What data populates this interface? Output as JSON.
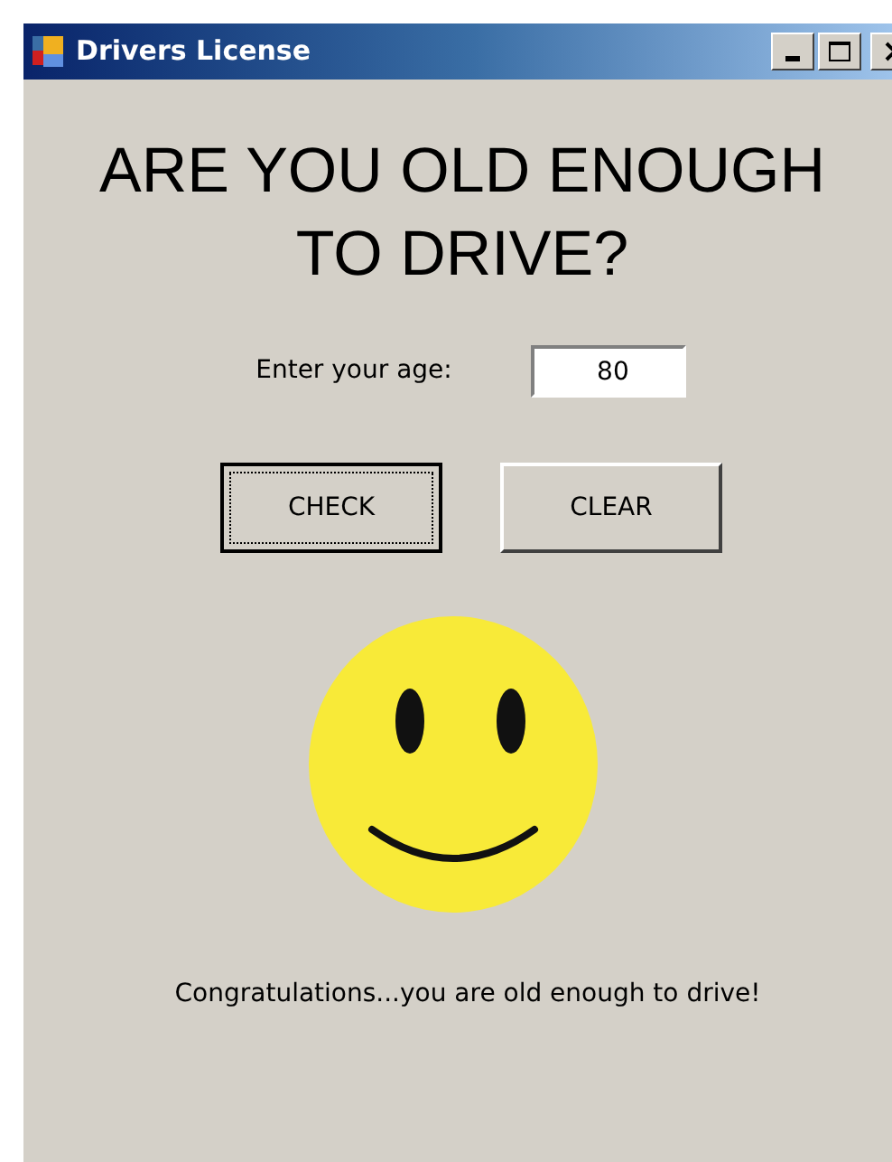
{
  "window": {
    "title": "Drivers License"
  },
  "heading": [
    "ARE YOU OLD ENOUGH",
    "TO DRIVE?"
  ],
  "age_field": {
    "label": "Enter your age:",
    "value": "80"
  },
  "buttons": [
    {
      "label": "CHECK",
      "focused": true
    },
    {
      "label": "CLEAR",
      "focused": false
    }
  ],
  "result": {
    "smiling": true,
    "message": "Congratulations...you are old enough to drive!"
  }
}
